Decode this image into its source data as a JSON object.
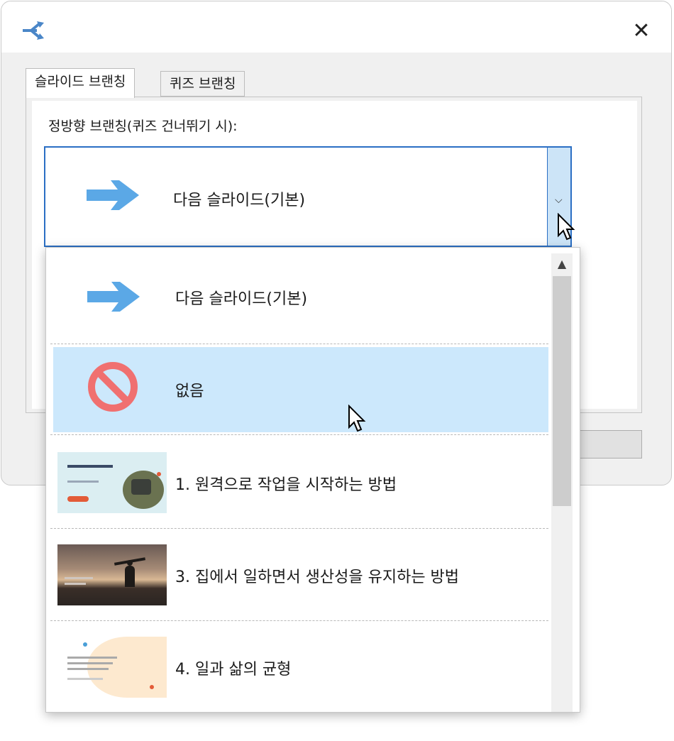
{
  "dialog": {
    "close_label": "✕",
    "tabs": [
      {
        "label": "슬라이드 브랜칭",
        "active": true
      },
      {
        "label": "퀴즈 브랜칭",
        "active": false
      }
    ],
    "field_label": "정방향 브랜칭(퀴즈 건너뛰기 시):",
    "combo": {
      "selected_label": "다음 슬라이드(기본)",
      "icon": "arrow-right-icon"
    }
  },
  "dropdown": {
    "items": [
      {
        "label": "다음 슬라이드(기본)",
        "icon": "arrow-right-icon",
        "selected": false
      },
      {
        "label": "없음",
        "icon": "no-entry-icon",
        "selected": true
      },
      {
        "label": "1. 원격으로 작업을 시작하는 방법",
        "thumb": "slide-thumb-remote-work"
      },
      {
        "label": "3. 집에서 일하면서 생산성을 유지하는 방법",
        "thumb": "slide-thumb-productivity"
      },
      {
        "label": "4. 일과 삶의 균형",
        "thumb": "slide-thumb-work-life-balance"
      }
    ]
  },
  "colors": {
    "accent": "#2b6fc4",
    "selection": "#cce8fc",
    "arrow": "#5ba8e6",
    "no_entry": "#f07070"
  }
}
